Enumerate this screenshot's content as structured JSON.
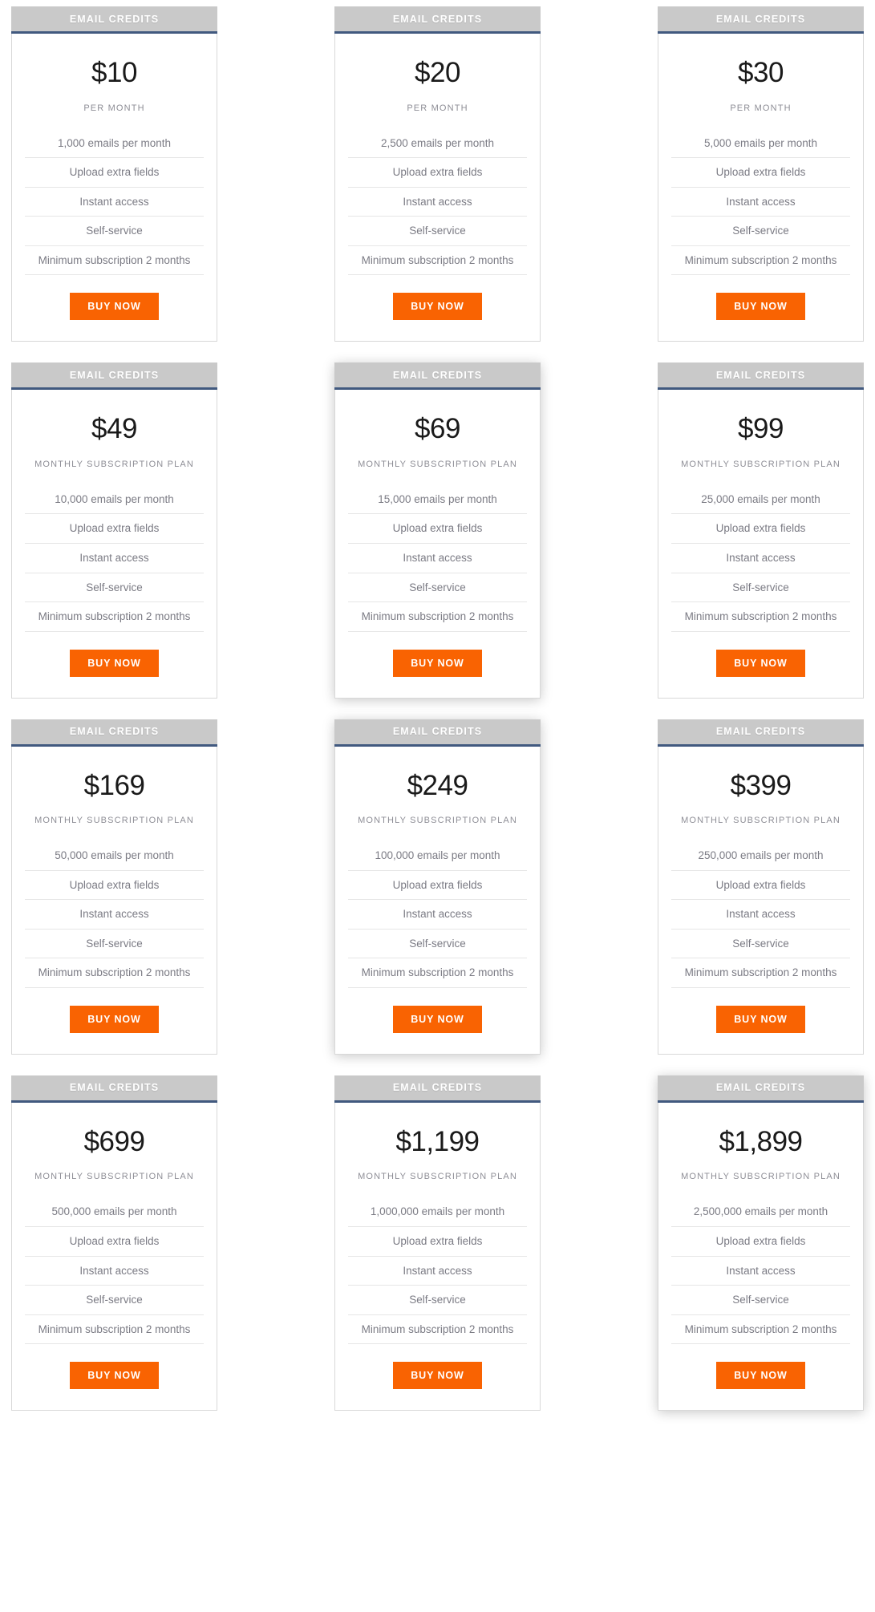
{
  "page": {
    "title": "Email Credits Pricing Plans",
    "accent_color": "#f96302",
    "header_band_color": "#c9c9c9",
    "header_rule_color": "#41597f",
    "buy_label": "BUY NOW",
    "header_label": "EMAIL CREDITS"
  },
  "rows": [
    {
      "cards": [
        {
          "header": "EMAIL CREDITS",
          "price": "$10",
          "period": "PER MONTH",
          "featured": false,
          "features": [
            "1,000 emails per month",
            "Upload extra fields",
            "Instant access",
            "Self-service",
            "Minimum subscription 2 months"
          ],
          "buy_label": "BUY NOW"
        },
        {
          "header": "EMAIL CREDITS",
          "price": "$20",
          "period": "PER MONTH",
          "featured": false,
          "features": [
            "2,500 emails per month",
            "Upload extra fields",
            "Instant access",
            "Self-service",
            "Minimum subscription 2 months"
          ],
          "buy_label": "BUY NOW"
        },
        {
          "header": "EMAIL CREDITS",
          "price": "$30",
          "period": "PER MONTH",
          "featured": false,
          "features": [
            "5,000 emails per month",
            "Upload extra fields",
            "Instant access",
            "Self-service",
            "Minimum subscription 2 months"
          ],
          "buy_label": "BUY NOW"
        }
      ]
    },
    {
      "cards": [
        {
          "header": "EMAIL CREDITS",
          "price": "$49",
          "period": "MONTHLY SUBSCRIPTION PLAN",
          "featured": false,
          "features": [
            "10,000 emails per month",
            "Upload extra fields",
            "Instant access",
            "Self-service",
            "Minimum subscription 2 months"
          ],
          "buy_label": "BUY NOW"
        },
        {
          "header": "EMAIL CREDITS",
          "price": "$69",
          "period": "MONTHLY SUBSCRIPTION PLAN",
          "featured": true,
          "features": [
            "15,000 emails per month",
            "Upload extra fields",
            "Instant access",
            "Self-service",
            "Minimum subscription 2 months"
          ],
          "buy_label": "BUY NOW"
        },
        {
          "header": "EMAIL CREDITS",
          "price": "$99",
          "period": "MONTHLY SUBSCRIPTION PLAN",
          "featured": false,
          "features": [
            "25,000 emails per month",
            "Upload extra fields",
            "Instant access",
            "Self-service",
            "Minimum subscription 2 months"
          ],
          "buy_label": "BUY NOW"
        }
      ]
    },
    {
      "cards": [
        {
          "header": "EMAIL CREDITS",
          "price": "$169",
          "period": "MONTHLY SUBSCRIPTION PLAN",
          "featured": false,
          "features": [
            "50,000 emails per month",
            "Upload extra fields",
            "Instant access",
            "Self-service",
            "Minimum subscription 2 months"
          ],
          "buy_label": "BUY NOW"
        },
        {
          "header": "EMAIL CREDITS",
          "price": "$249",
          "period": "MONTHLY SUBSCRIPTION PLAN",
          "featured": true,
          "features": [
            "100,000 emails per month",
            "Upload extra fields",
            "Instant access",
            "Self-service",
            "Minimum subscription 2 months"
          ],
          "buy_label": "BUY NOW"
        },
        {
          "header": "EMAIL CREDITS",
          "price": "$399",
          "period": "MONTHLY SUBSCRIPTION PLAN",
          "featured": false,
          "features": [
            "250,000 emails per month",
            "Upload extra fields",
            "Instant access",
            "Self-service",
            "Minimum subscription 2 months"
          ],
          "buy_label": "BUY NOW"
        }
      ]
    },
    {
      "cards": [
        {
          "header": "EMAIL CREDITS",
          "price": "$699",
          "period": "MONTHLY SUBSCRIPTION PLAN",
          "featured": false,
          "features": [
            "500,000 emails per month",
            "Upload extra fields",
            "Instant access",
            "Self-service",
            "Minimum subscription 2 months"
          ],
          "buy_label": "BUY NOW"
        },
        {
          "header": "EMAIL CREDITS",
          "price": "$1,199",
          "period": "MONTHLY SUBSCRIPTION PLAN",
          "featured": false,
          "features": [
            "1,000,000 emails per month",
            "Upload extra fields",
            "Instant access",
            "Self-service",
            "Minimum subscription 2 months"
          ],
          "buy_label": "BUY NOW"
        },
        {
          "header": "EMAIL CREDITS",
          "price": "$1,899",
          "period": "MONTHLY SUBSCRIPTION PLAN",
          "featured": true,
          "features": [
            "2,500,000 emails per month",
            "Upload extra fields",
            "Instant access",
            "Self-service",
            "Minimum subscription 2 months"
          ],
          "buy_label": "BUY NOW"
        }
      ]
    }
  ]
}
